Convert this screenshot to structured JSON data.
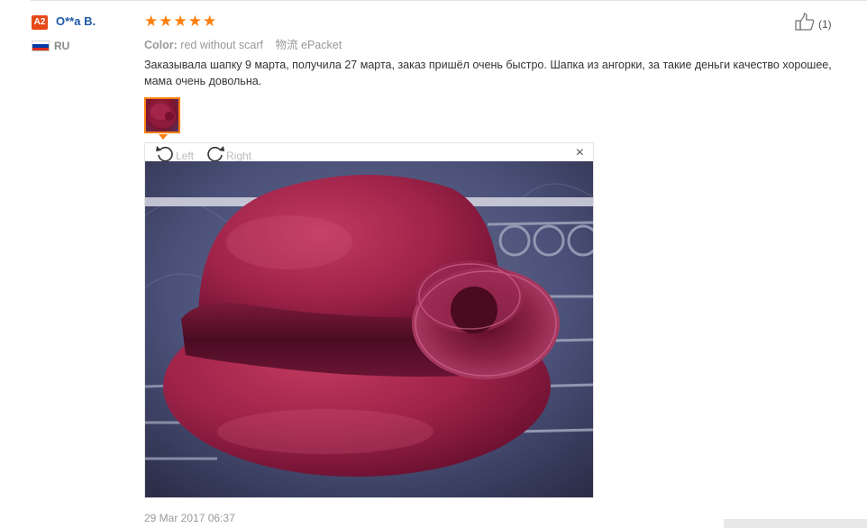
{
  "user": {
    "level": "A2",
    "name": "O**a B.",
    "country": "RU",
    "flag_colors": [
      "#ffffff",
      "#0039a6",
      "#d52b1e"
    ]
  },
  "review": {
    "rating": 5,
    "star_color": "#ff7e0f",
    "stars": [
      "★",
      "★",
      "★",
      "★",
      "★"
    ],
    "helpful_count": "(1)",
    "color_label": "Color:",
    "color_value": "red without scarf",
    "shipping_label": "物流",
    "shipping_value": "ePacket",
    "text": "Заказывала шапку 9 марта, получила 27 марта, заказ пришёл очень быстро. Шапка из ангорки, за такие деньги качество хорошее, мама очень довольна.",
    "date": "29 Mar 2017 06:37"
  },
  "viewer": {
    "rotate_left_label": "Left",
    "rotate_right_label": "Right",
    "close_label": "×"
  },
  "icons": {
    "thumb_up": "thumb-up-icon",
    "rotate_left": "rotate-left-icon",
    "rotate_right": "rotate-right-icon",
    "close": "close-icon"
  }
}
